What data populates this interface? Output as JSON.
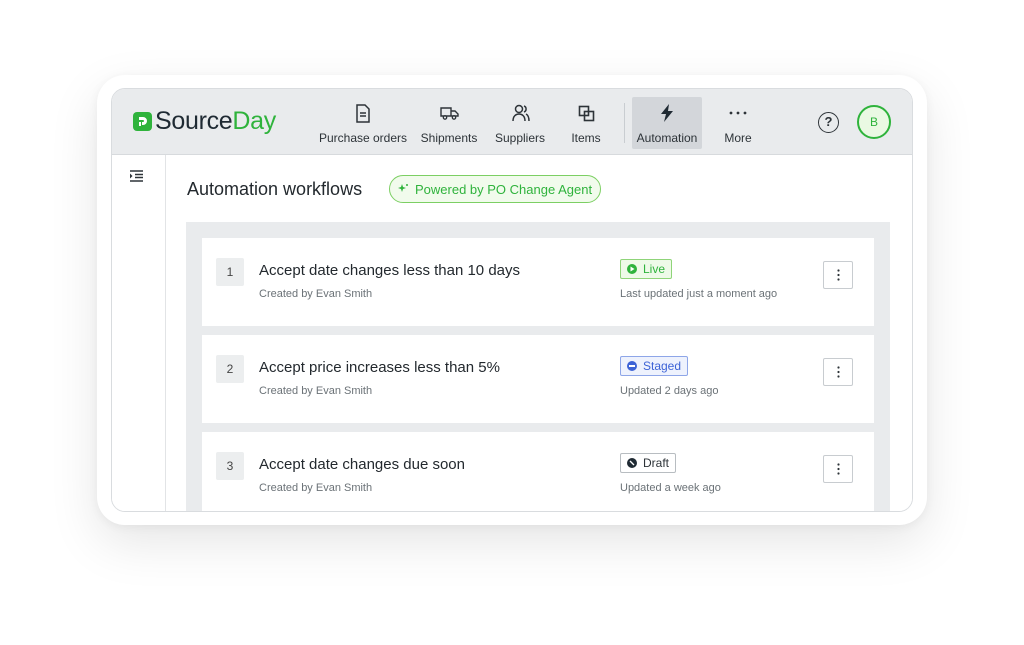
{
  "app": {
    "logo_source": "Source",
    "logo_day": "Day"
  },
  "nav": {
    "items": [
      {
        "label": "Purchase orders",
        "icon": "document-icon"
      },
      {
        "label": "Shipments",
        "icon": "truck-icon"
      },
      {
        "label": "Suppliers",
        "icon": "users-icon"
      },
      {
        "label": "Items",
        "icon": "items-icon"
      },
      {
        "label": "Automation",
        "icon": "lightning-icon",
        "active": true
      },
      {
        "label": "More",
        "icon": "more-dots-icon"
      }
    ],
    "help_label": "?",
    "avatar_initial": "B"
  },
  "page": {
    "title": "Automation workflows",
    "badge": "Powered by PO Change Agent"
  },
  "workflows": [
    {
      "number": "1",
      "title": "Accept date changes less than 10 days",
      "created_by": "Created by Evan Smith",
      "status": "Live",
      "updated": "Last updated just a moment ago"
    },
    {
      "number": "2",
      "title": "Accept price increases less than 5%",
      "created_by": "Created by Evan Smith",
      "status": "Staged",
      "updated": "Updated 2 days ago"
    },
    {
      "number": "3",
      "title": "Accept date changes due soon",
      "created_by": "Created by Evan Smith",
      "status": "Draft",
      "updated": "Updated a week ago"
    }
  ],
  "colors": {
    "brand_green": "#2fb33c",
    "staged_blue": "#3d63d6",
    "topbar": "#e9ebed"
  }
}
